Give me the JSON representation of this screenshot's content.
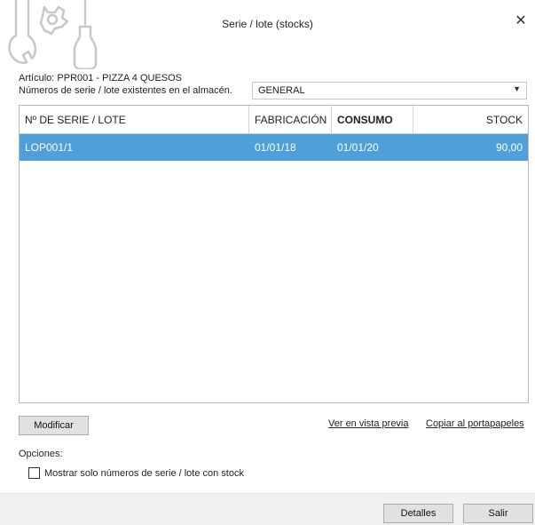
{
  "window": {
    "title": "Serie / lote (stocks)",
    "close_glyph": "✕"
  },
  "article": {
    "label": "Artículo: PPR001 - PIZZA 4 QUESOS"
  },
  "warehouse": {
    "label": "Números de serie / lote existentes en el almacén.",
    "selected": "GENERAL",
    "arrow_glyph": "▼"
  },
  "grid": {
    "columns": [
      "Nº DE SERIE / LOTE",
      "FABRICACIÓN",
      "CONSUMO",
      "STOCK"
    ],
    "rows": [
      [
        "LOP001/1",
        "01/01/18",
        "01/01/20",
        "90,00"
      ]
    ]
  },
  "actions": {
    "modify_label": "Modificar",
    "preview_label": "Ver en vista previa",
    "copy_label": "Copiar al portapapeles"
  },
  "options": {
    "label": "Opciones:",
    "stock_only_label": "Mostrar solo números de serie / lote con stock",
    "stock_only_checked": false
  },
  "footer": {
    "details_label": "Detalles",
    "exit_label": "Salir"
  },
  "colors": {
    "selection": "#4f9fda",
    "icon": "#c7c7c7"
  }
}
